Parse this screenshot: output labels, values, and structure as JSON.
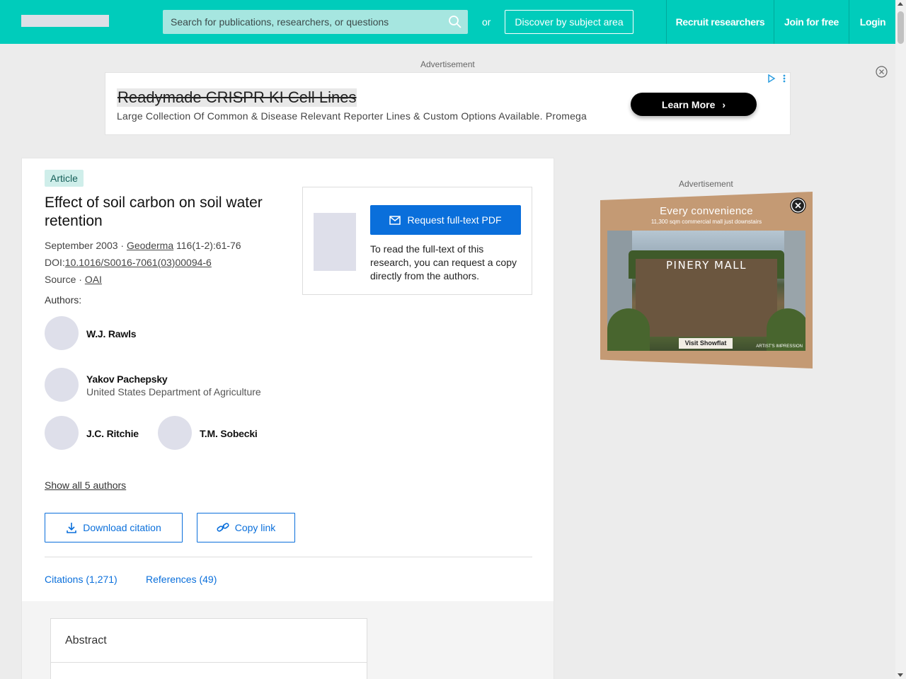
{
  "header": {
    "search_placeholder": "Search for publications, researchers, or questions",
    "or_label": "or",
    "discover_label": "Discover by subject area",
    "nav": {
      "recruit": "Recruit researchers",
      "join": "Join for free",
      "login": "Login"
    }
  },
  "top_ad": {
    "label": "Advertisement",
    "title": "Readymade CRISPR KI Cell Lines",
    "description": "Large Collection Of Common & Disease Relevant Reporter Lines & Custom Options Available. Promega",
    "cta": "Learn More"
  },
  "article": {
    "badge": "Article",
    "title": "Effect of soil carbon on soil water retention",
    "date": "September 2003 · ",
    "journal": "Geoderma",
    "volume": " 116(1-2):61-76",
    "doi_prefix": "DOI:",
    "doi": "10.1016/S0016-7061(03)00094-6",
    "source_prefix": "Source · ",
    "source": "OAI",
    "authors_label": "Authors:",
    "authors": [
      {
        "name": "W.J. Rawls",
        "affiliation": ""
      },
      {
        "name": "Yakov Pachepsky",
        "affiliation": "United States Department of Agriculture"
      },
      {
        "name": "J.C. Ritchie",
        "affiliation": ""
      },
      {
        "name": "T.M. Sobecki",
        "affiliation": ""
      }
    ],
    "show_all": "Show all 5 authors",
    "download_citation": "Download citation",
    "copy_link": "Copy link",
    "tabs": {
      "citations": "Citations (1,271)",
      "references": "References (49)"
    },
    "abstract_title": "Abstract"
  },
  "request": {
    "button": "Request full-text PDF",
    "text": "To read the full-text of this research, you can request a copy directly from the authors."
  },
  "side_ad": {
    "label": "Advertisement",
    "headline": "Every convenience",
    "subheadline": "11,300 sqm commercial mall just downstairs",
    "mall_name": "PINERY MALL",
    "cta": "Visit Showflat",
    "note": "ARTIST'S IMPRESSION"
  },
  "colors": {
    "brand": "#00ccbb",
    "link_blue": "#0a6fdb",
    "badge_bg": "#cfeeea"
  }
}
